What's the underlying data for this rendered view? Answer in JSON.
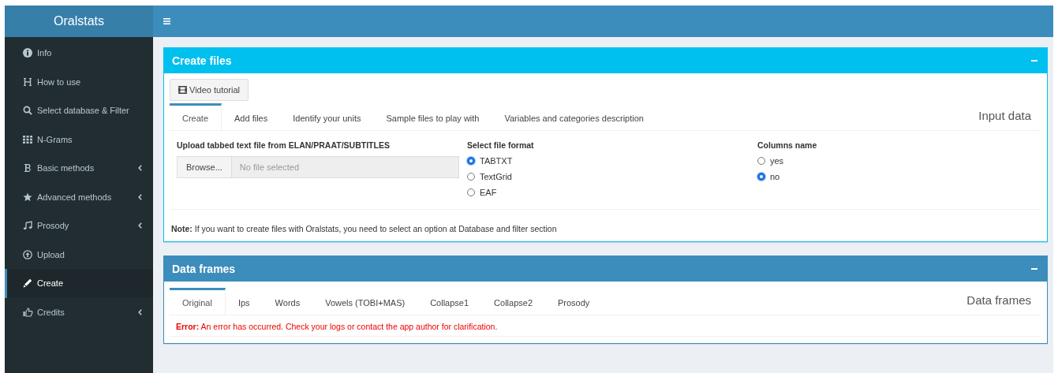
{
  "app": {
    "title": "Oralstats"
  },
  "sidebar": {
    "items": [
      {
        "label": "Info",
        "kind": "info",
        "expandable": false,
        "selected": false
      },
      {
        "label": "How to use",
        "kind": "heading",
        "expandable": false,
        "selected": false
      },
      {
        "label": "Select database & Filter",
        "kind": "search",
        "expandable": false,
        "selected": false
      },
      {
        "label": "N-Grams",
        "kind": "grid",
        "expandable": false,
        "selected": false
      },
      {
        "label": "Basic methods",
        "kind": "bold",
        "expandable": true,
        "selected": false
      },
      {
        "label": "Advanced methods",
        "kind": "star",
        "expandable": true,
        "selected": false
      },
      {
        "label": "Prosody",
        "kind": "music",
        "expandable": true,
        "selected": false
      },
      {
        "label": "Upload",
        "kind": "upload",
        "expandable": false,
        "selected": false
      },
      {
        "label": "Create",
        "kind": "pencil",
        "expandable": false,
        "selected": true
      },
      {
        "label": "Credits",
        "kind": "thumb",
        "expandable": true,
        "selected": false
      }
    ]
  },
  "create_box": {
    "title": "Create files",
    "video_button": "Video tutorial",
    "tabs": [
      {
        "label": "Create",
        "selected": true
      },
      {
        "label": "Add files",
        "selected": false
      },
      {
        "label": "Identify your units",
        "selected": false
      },
      {
        "label": "Sample files to play with",
        "selected": false
      },
      {
        "label": "Variables and categories description",
        "selected": false
      }
    ],
    "panel_title": "Input data",
    "upload": {
      "label": "Upload tabbed text file from ELAN/PRAAT/SUBTITLES",
      "button": "Browse...",
      "placeholder": "No file selected"
    },
    "file_format": {
      "label": "Select file format",
      "options": [
        {
          "label": "TABTXT",
          "selected": true
        },
        {
          "label": "TextGrid",
          "selected": false
        },
        {
          "label": "EAF",
          "selected": false
        }
      ]
    },
    "columns_name": {
      "label": "Columns name",
      "options": [
        {
          "label": "yes",
          "selected": false
        },
        {
          "label": "no",
          "selected": true
        }
      ]
    },
    "note": "**Note:** If you want to create files with Oralstats, you need to select an option at Database and filter section"
  },
  "data_box": {
    "title": "Data frames",
    "tabs": [
      {
        "label": "Original",
        "selected": true
      },
      {
        "label": "Ips",
        "selected": false
      },
      {
        "label": "Words",
        "selected": false
      },
      {
        "label": "Vowels (TOBI+MAS)",
        "selected": false
      },
      {
        "label": "Collapse1",
        "selected": false
      },
      {
        "label": "Collapse2",
        "selected": false
      },
      {
        "label": "Prosody",
        "selected": false
      }
    ],
    "panel_title": "Data frames",
    "error": "**Error:** An error has occurred. Check your logs or contact the app author for clarification."
  }
}
